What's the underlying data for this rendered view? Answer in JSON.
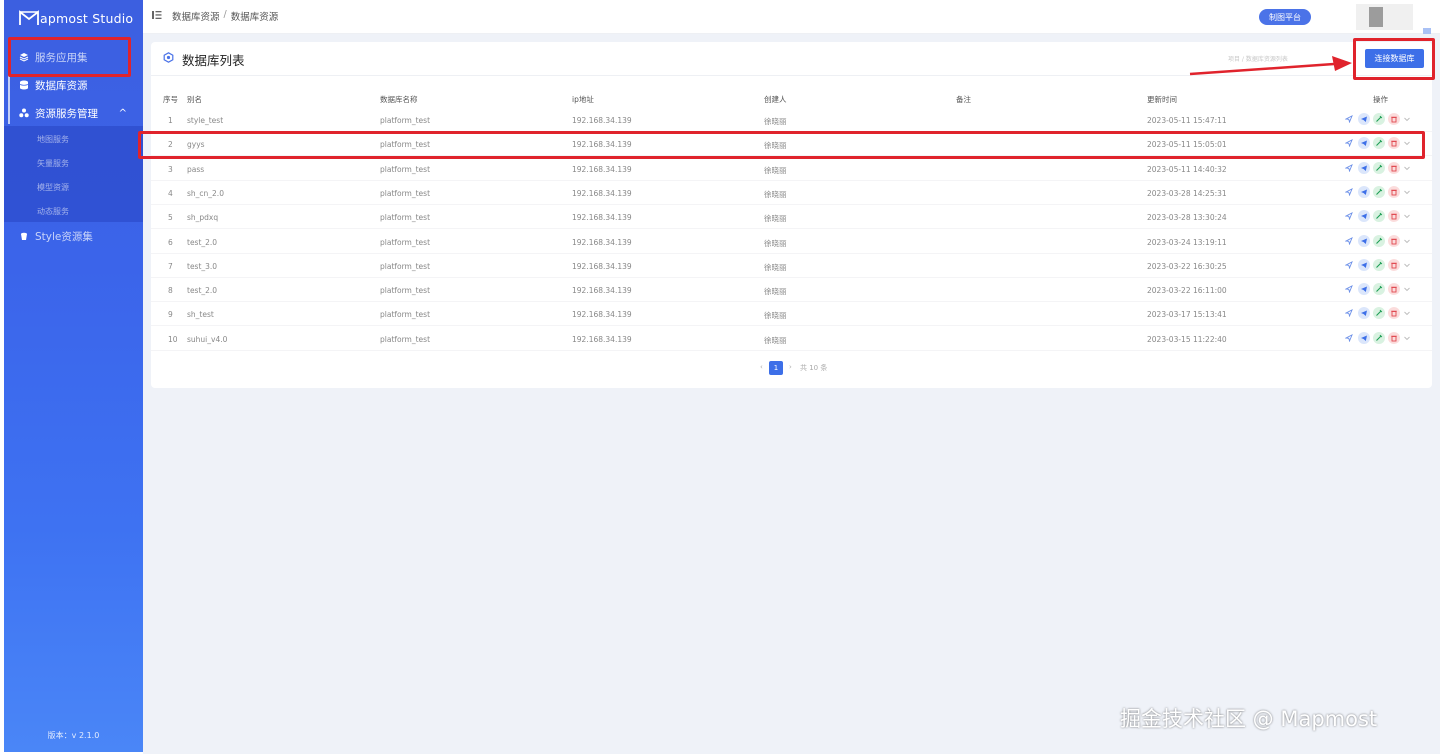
{
  "app": {
    "name": "apmost Studio",
    "version": "版本：v 2.1.0"
  },
  "sidebar": {
    "items": [
      {
        "label": "服务应用集"
      },
      {
        "label": "数据库资源"
      },
      {
        "label": "资源服务管理",
        "chevron": "^"
      },
      {
        "label": "Style资源集"
      }
    ],
    "submenu": [
      "地图服务",
      "矢量服务",
      "模型资源",
      "动态服务"
    ]
  },
  "header": {
    "breadcrumb": [
      "数据库资源",
      "数据库资源"
    ],
    "separator": "/",
    "platform_button": "制图平台"
  },
  "card": {
    "title": "数据库列表",
    "faint_text": "项目 / 数据库资源列表",
    "connect_button": "连接数据库"
  },
  "table": {
    "columns": [
      "序号",
      "别名",
      "数据库名称",
      "ip地址",
      "创建人",
      "备注",
      "更新时间",
      "操作"
    ],
    "rows": [
      {
        "idx": "1",
        "alias": "style_test",
        "db": "platform_test",
        "ip": "192.168.34.139",
        "creator": "徐晓丽",
        "remark": "",
        "updated": "2023-05-11 15:47:11"
      },
      {
        "idx": "2",
        "alias": "gyys",
        "db": "platform_test",
        "ip": "192.168.34.139",
        "creator": "徐晓丽",
        "remark": "",
        "updated": "2023-05-11 15:05:01"
      },
      {
        "idx": "3",
        "alias": "pass",
        "db": "platform_test",
        "ip": "192.168.34.139",
        "creator": "徐晓丽",
        "remark": "",
        "updated": "2023-05-11 14:40:32"
      },
      {
        "idx": "4",
        "alias": "sh_cn_2.0",
        "db": "platform_test",
        "ip": "192.168.34.139",
        "creator": "徐晓丽",
        "remark": "",
        "updated": "2023-03-28 14:25:31"
      },
      {
        "idx": "5",
        "alias": "sh_pdxq",
        "db": "platform_test",
        "ip": "192.168.34.139",
        "creator": "徐晓丽",
        "remark": "",
        "updated": "2023-03-28 13:30:24"
      },
      {
        "idx": "6",
        "alias": "test_2.0",
        "db": "platform_test",
        "ip": "192.168.34.139",
        "creator": "徐晓丽",
        "remark": "",
        "updated": "2023-03-24 13:19:11"
      },
      {
        "idx": "7",
        "alias": "test_3.0",
        "db": "platform_test",
        "ip": "192.168.34.139",
        "creator": "徐晓丽",
        "remark": "",
        "updated": "2023-03-22 16:30:25"
      },
      {
        "idx": "8",
        "alias": "test_2.0",
        "db": "platform_test",
        "ip": "192.168.34.139",
        "creator": "徐晓丽",
        "remark": "",
        "updated": "2023-03-22 16:11:00"
      },
      {
        "idx": "9",
        "alias": "sh_test",
        "db": "platform_test",
        "ip": "192.168.34.139",
        "creator": "徐晓丽",
        "remark": "",
        "updated": "2023-03-17 15:13:41"
      },
      {
        "idx": "10",
        "alias": "suhui_v4.0",
        "db": "platform_test",
        "ip": "192.168.34.139",
        "creator": "徐晓丽",
        "remark": "",
        "updated": "2023-03-15 11:22:40"
      }
    ],
    "row_actions": [
      "send-icon",
      "telegram-icon",
      "edit-icon",
      "delete-icon",
      "chevron-down-icon"
    ]
  },
  "pagination": {
    "prev": "‹",
    "current": "1",
    "next": "›",
    "total": "共 10 条"
  },
  "annotations": {
    "highlight_color": "#e0232c"
  },
  "watermark": "掘金技术社区 @ Mapmost",
  "colors": {
    "primary": "#3d6fe8",
    "sidebar": "#3b64ea",
    "background": "#eff2f8"
  }
}
